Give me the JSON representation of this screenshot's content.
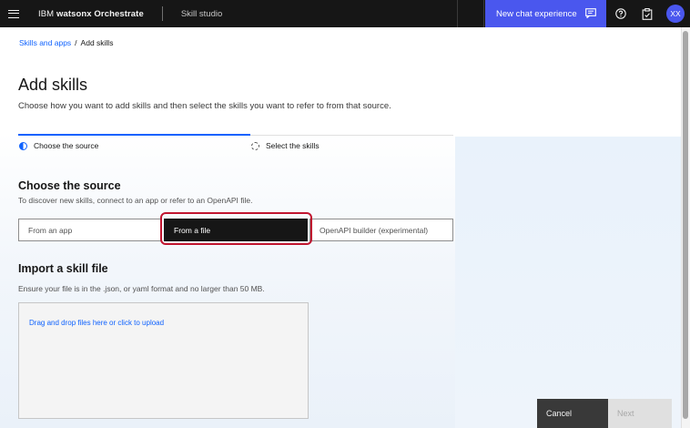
{
  "header": {
    "brand_prefix": "IBM",
    "brand_name": "watsonx Orchestrate",
    "section": "Skill studio",
    "new_chat_label": "New chat experience",
    "avatar_initials": "XX",
    "icons": [
      "menu-icon",
      "chat-icon",
      "help-icon",
      "clipboard-check-icon"
    ]
  },
  "breadcrumb": {
    "link": "Skills and apps",
    "separator": "/",
    "current": "Add skills"
  },
  "page": {
    "title": "Add skills",
    "description": "Choose how you want to add skills and then select the skills you want to refer to from that source."
  },
  "stepper": {
    "steps": [
      {
        "label": "Choose the source",
        "state": "current"
      },
      {
        "label": "Select the skills",
        "state": "incomplete"
      }
    ]
  },
  "source": {
    "title": "Choose the source",
    "description": "To discover new skills, connect to an app or refer to an OpenAPI file.",
    "options": [
      {
        "label": "From an app",
        "selected": false
      },
      {
        "label": "From a file",
        "selected": true
      },
      {
        "label": "OpenAPI builder (experimental)",
        "selected": false
      }
    ]
  },
  "import": {
    "title": "Import a skill file",
    "description": "Ensure your file is in the .json, or yaml format and no larger than 50 MB.",
    "dropzone_label": "Drag and drop files here or click to upload"
  },
  "footer": {
    "cancel_label": "Cancel",
    "next_label": "Next"
  },
  "colors": {
    "accent": "#0f62fe",
    "new_chat_bg": "#4a57ee",
    "highlight": "#c0152f"
  }
}
